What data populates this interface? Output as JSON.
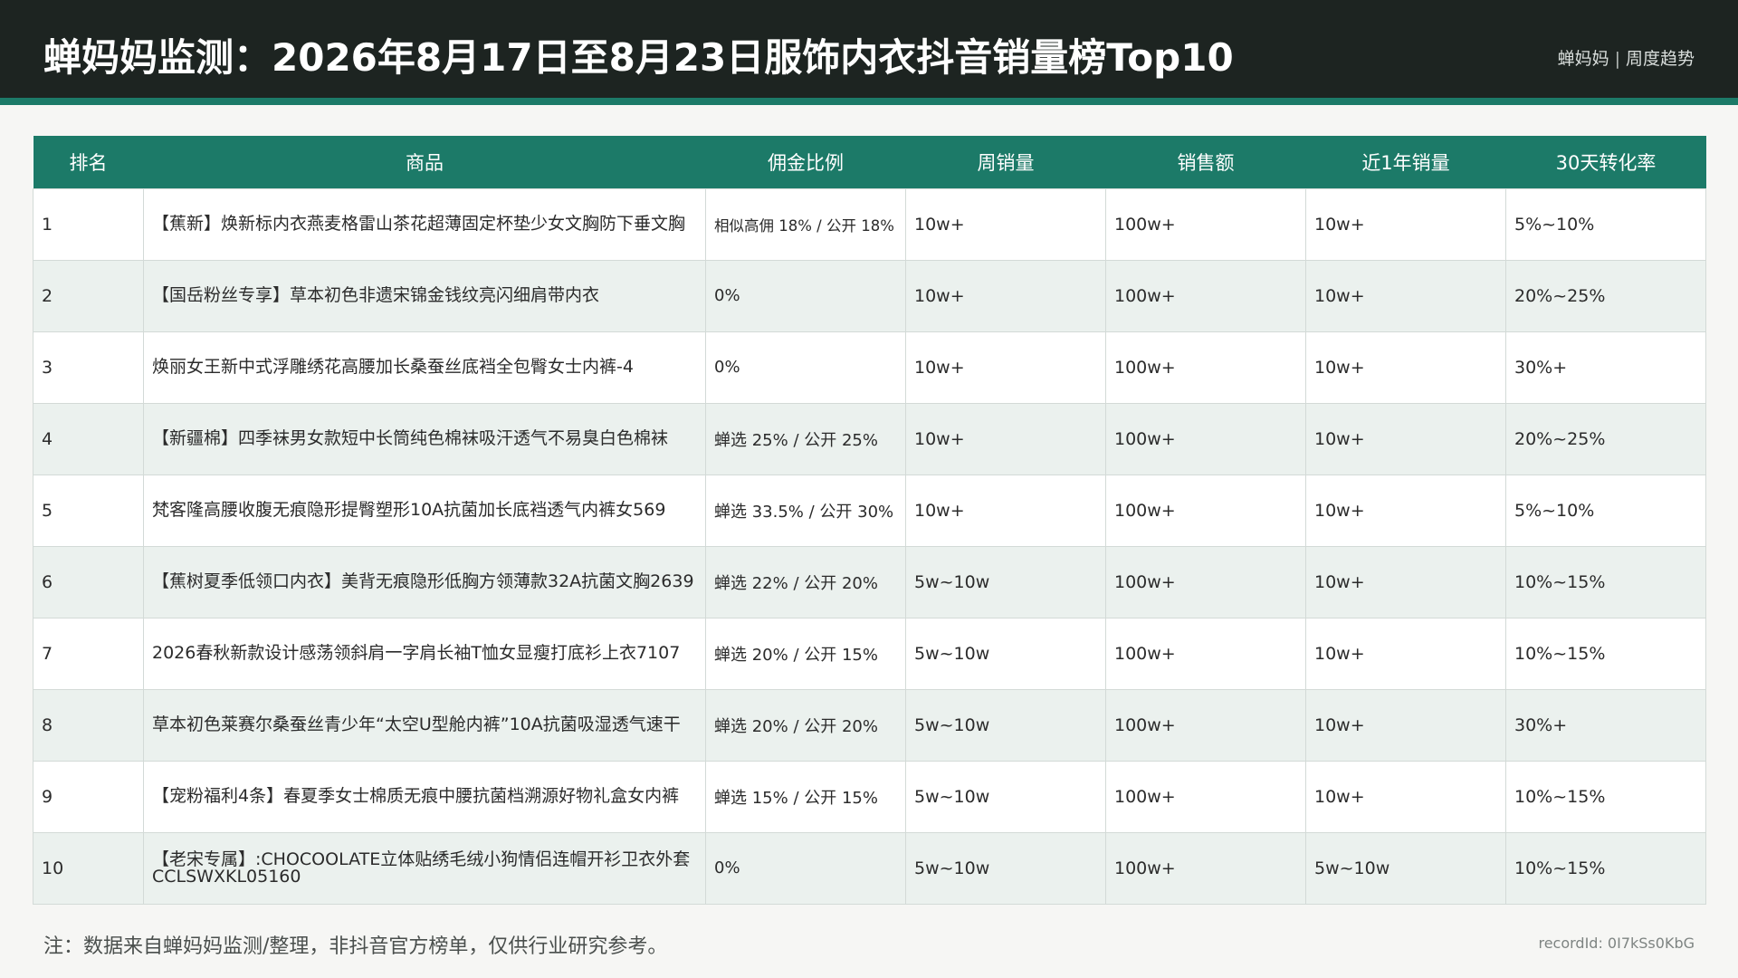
{
  "header": {
    "title": "蝉妈妈监测：2026年8月17日至8月23日服饰内衣抖音销量榜Top10",
    "brand": "蝉妈妈",
    "brand_sep": "|",
    "brand_sub": "周度趋势"
  },
  "table": {
    "columns": [
      "排名",
      "商品",
      "佣金比例",
      "周销量",
      "销售额",
      "近1年销量",
      "30天转化率"
    ],
    "rows": [
      {
        "rank": "1",
        "product": "【蕉新】焕新标内衣燕麦格雷山茶花超薄固定杯垫少女文胸防下垂文胸",
        "commission": "相似高佣 18% / 公开 18%",
        "weekly_sales": "10w+",
        "revenue": "100w+",
        "yearly_sales": "10w+",
        "conversion": "5%~10%"
      },
      {
        "rank": "2",
        "product": "【国岳粉丝专享】草本初色非遗宋锦金钱纹亮闪细肩带内衣",
        "commission": "0%",
        "weekly_sales": "10w+",
        "revenue": "100w+",
        "yearly_sales": "10w+",
        "conversion": "20%~25%"
      },
      {
        "rank": "3",
        "product": "焕丽女王新中式浮雕绣花高腰加长桑蚕丝底裆全包臀女士内裤-4",
        "commission": "0%",
        "weekly_sales": "10w+",
        "revenue": "100w+",
        "yearly_sales": "10w+",
        "conversion": "30%+"
      },
      {
        "rank": "4",
        "product": "【新疆棉】四季袜男女款短中长筒纯色棉袜吸汗透气不易臭白色棉袜",
        "commission": "蝉选 25% / 公开 25%",
        "weekly_sales": "10w+",
        "revenue": "100w+",
        "yearly_sales": "10w+",
        "conversion": "20%~25%"
      },
      {
        "rank": "5",
        "product": "梵客隆高腰收腹无痕隐形提臀塑形10A抗菌加长底裆透气内裤女569",
        "commission": "蝉选 33.5% / 公开 30%",
        "weekly_sales": "10w+",
        "revenue": "100w+",
        "yearly_sales": "10w+",
        "conversion": "5%~10%"
      },
      {
        "rank": "6",
        "product": "【蕉树夏季低领口内衣】美背无痕隐形低胸方领薄款32A抗菌文胸2639",
        "commission": "蝉选 22% / 公开 20%",
        "weekly_sales": "5w~10w",
        "revenue": "100w+",
        "yearly_sales": "10w+",
        "conversion": "10%~15%"
      },
      {
        "rank": "7",
        "product": "2026春秋新款设计感荡领斜肩一字肩长袖T恤女显瘦打底衫上衣7107",
        "commission": "蝉选 20% / 公开 15%",
        "weekly_sales": "5w~10w",
        "revenue": "100w+",
        "yearly_sales": "10w+",
        "conversion": "10%~15%"
      },
      {
        "rank": "8",
        "product": "草本初色莱赛尔桑蚕丝青少年“太空U型舱内裤”10A抗菌吸湿透气速干",
        "commission": "蝉选 20% / 公开 20%",
        "weekly_sales": "5w~10w",
        "revenue": "100w+",
        "yearly_sales": "10w+",
        "conversion": "30%+"
      },
      {
        "rank": "9",
        "product": "【宠粉福利4条】春夏季女士棉质无痕中腰抗菌档溯源好物礼盒女内裤",
        "commission": "蝉选 15% / 公开 15%",
        "weekly_sales": "5w~10w",
        "revenue": "100w+",
        "yearly_sales": "10w+",
        "conversion": "10%~15%"
      },
      {
        "rank": "10",
        "product": "【老宋专属】:CHOCOOLATE立体贴绣毛绒小狗情侣连帽开衫卫衣外套CCLSWXKL05160",
        "commission": "0%",
        "weekly_sales": "5w~10w",
        "revenue": "100w+",
        "yearly_sales": "5w~10w",
        "conversion": "10%~15%"
      }
    ]
  },
  "footer": {
    "note": "注：数据来自蝉妈妈监测/整理，非抖音官方榜单，仅供行业研究参考。",
    "record_id": "recordId: 0I7kSs0KbG"
  }
}
